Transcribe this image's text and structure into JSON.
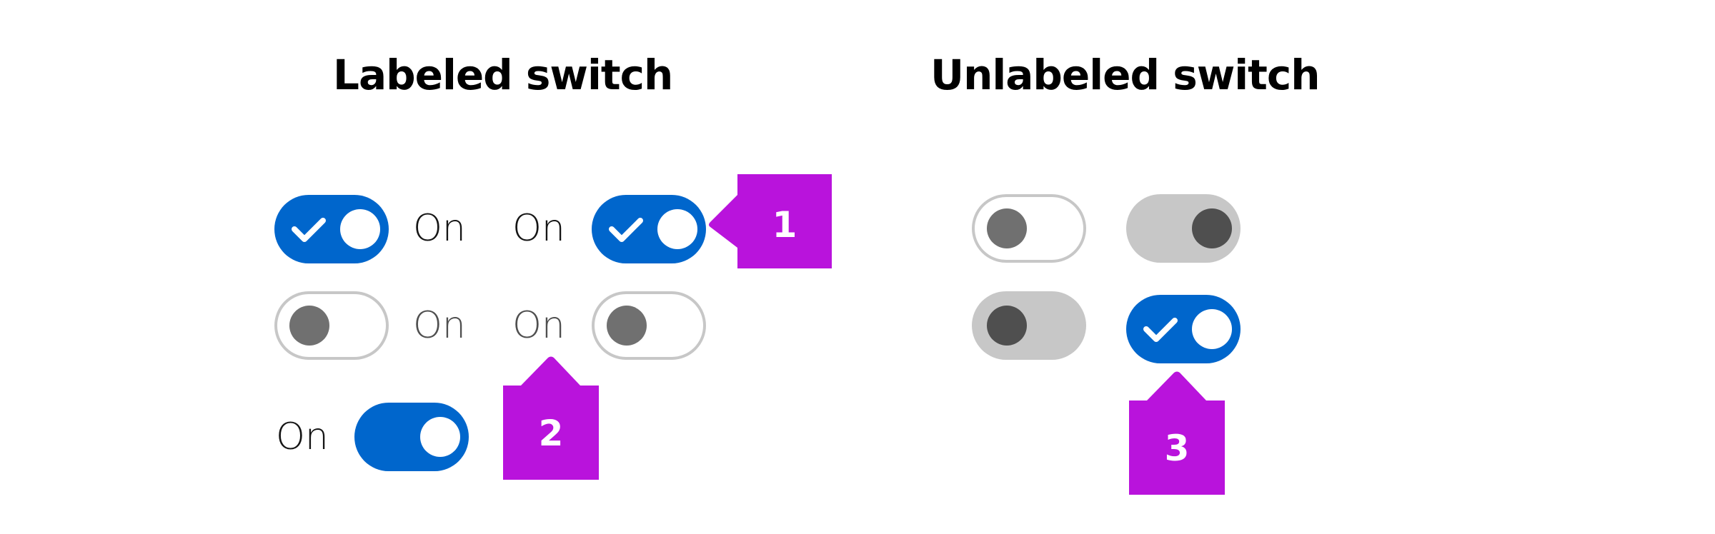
{
  "sections": {
    "labeled": {
      "title": "Labeled switch"
    },
    "unlabeled": {
      "title": "Unlabeled switch"
    }
  },
  "labeled_switches": [
    {
      "label": "On",
      "label_position": "after",
      "state": "on",
      "show_check_icon": true,
      "disabled": false
    },
    {
      "label": "On",
      "label_position": "before",
      "state": "on",
      "show_check_icon": true,
      "disabled": false
    },
    {
      "label": "On",
      "label_position": "after",
      "state": "off",
      "show_check_icon": false,
      "disabled": false
    },
    {
      "label": "On",
      "label_position": "before",
      "state": "off",
      "show_check_icon": false,
      "disabled": false
    },
    {
      "label": "On",
      "label_position": "before",
      "state": "on",
      "show_check_icon": false,
      "disabled": false
    }
  ],
  "unlabeled_switches": [
    {
      "state": "off",
      "disabled": false
    },
    {
      "state": "on",
      "disabled": true
    },
    {
      "state": "off",
      "disabled": true
    },
    {
      "state": "on",
      "show_check_icon": true,
      "disabled": false
    }
  ],
  "callouts": [
    {
      "number": "1",
      "points_to": "right-side labeled switch (on)"
    },
    {
      "number": "2",
      "points_to": "label text of off switch"
    },
    {
      "number": "3",
      "points_to": "unlabeled switch with check icon"
    }
  ],
  "colors": {
    "switch_on": "#0066cc",
    "switch_off_border": "#c7c7c7",
    "knob_off": "#707070",
    "disabled_track": "#c7c7c7",
    "disabled_knob": "#4f4f4f",
    "callout": "#b913dc",
    "text": "#151515",
    "text_muted": "#4f4f4f"
  }
}
